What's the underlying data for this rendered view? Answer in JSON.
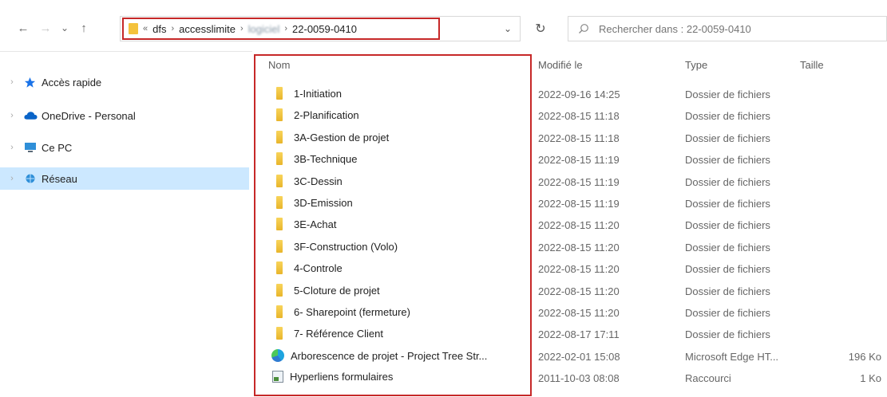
{
  "toolbar": {
    "back_icon": "←",
    "forward_icon": "→",
    "recent_icon": "⌄",
    "up_icon": "↑",
    "refresh_icon": "↻",
    "dropdown_icon": "⌄"
  },
  "address": {
    "overflow": "«",
    "crumbs": [
      "dfs",
      "accesslimite",
      "logiciel",
      "22-0059-0410"
    ],
    "separator": "›"
  },
  "search": {
    "placeholder": "Rechercher dans : 22-0059-0410",
    "icon": "search-icon"
  },
  "sidebar": {
    "items": [
      {
        "label": "Accès rapide",
        "icon": "star-icon",
        "color": "#1a73e8"
      },
      {
        "label": "OneDrive - Personal",
        "icon": "cloud-icon",
        "color": "#0a64c8"
      },
      {
        "label": "Ce PC",
        "icon": "computer-icon",
        "color": "#2f8fd8"
      },
      {
        "label": "Réseau",
        "icon": "network-icon",
        "color": "#2f8fd8",
        "selected": true
      }
    ]
  },
  "columns": {
    "name": "Nom",
    "modified": "Modifié le",
    "type": "Type",
    "size": "Taille"
  },
  "files": [
    {
      "name": "1-Initiation",
      "modified": "2022-09-16 14:25",
      "type": "Dossier de fichiers",
      "size": "",
      "icon": "folder-icon"
    },
    {
      "name": "2-Planification",
      "modified": "2022-08-15 11:18",
      "type": "Dossier de fichiers",
      "size": "",
      "icon": "folder-icon"
    },
    {
      "name": "3A-Gestion de projet",
      "modified": "2022-08-15 11:18",
      "type": "Dossier de fichiers",
      "size": "",
      "icon": "folder-icon"
    },
    {
      "name": "3B-Technique",
      "modified": "2022-08-15 11:19",
      "type": "Dossier de fichiers",
      "size": "",
      "icon": "folder-icon"
    },
    {
      "name": "3C-Dessin",
      "modified": "2022-08-15 11:19",
      "type": "Dossier de fichiers",
      "size": "",
      "icon": "folder-icon"
    },
    {
      "name": "3D-Emission",
      "modified": "2022-08-15 11:19",
      "type": "Dossier de fichiers",
      "size": "",
      "icon": "folder-icon"
    },
    {
      "name": "3E-Achat",
      "modified": "2022-08-15 11:20",
      "type": "Dossier de fichiers",
      "size": "",
      "icon": "folder-icon"
    },
    {
      "name": "3F-Construction (Volo)",
      "modified": "2022-08-15 11:20",
      "type": "Dossier de fichiers",
      "size": "",
      "icon": "folder-icon"
    },
    {
      "name": "4-Controle",
      "modified": "2022-08-15 11:20",
      "type": "Dossier de fichiers",
      "size": "",
      "icon": "folder-icon"
    },
    {
      "name": "5-Cloture de projet",
      "modified": "2022-08-15 11:20",
      "type": "Dossier de fichiers",
      "size": "",
      "icon": "folder-icon"
    },
    {
      "name": "6- Sharepoint (fermeture)",
      "modified": "2022-08-15 11:20",
      "type": "Dossier de fichiers",
      "size": "",
      "icon": "folder-icon"
    },
    {
      "name": "7- Référence Client",
      "modified": "2022-08-17 17:11",
      "type": "Dossier de fichiers",
      "size": "",
      "icon": "folder-icon"
    },
    {
      "name": "Arborescence de projet - Project Tree Str...",
      "modified": "2022-02-01 15:08",
      "type": "Microsoft Edge HT...",
      "size": "196 Ko",
      "icon": "edge-icon"
    },
    {
      "name": "Hyperliens formulaires",
      "modified": "2011-10-03 08:08",
      "type": "Raccourci",
      "size": "1 Ko",
      "icon": "shortcut-icon"
    }
  ],
  "colors": {
    "highlight_border": "#c62828",
    "selection": "#cce8ff",
    "folder": "#f4c23c"
  }
}
